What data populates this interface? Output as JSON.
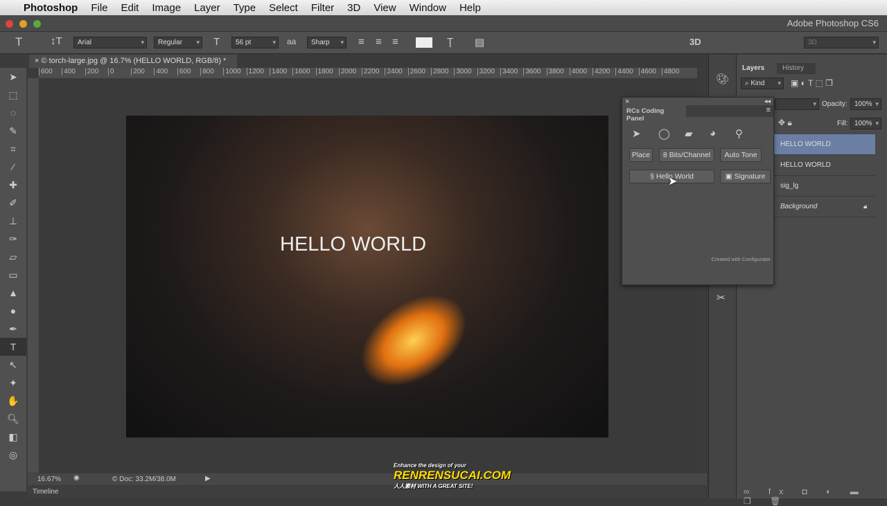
{
  "menubar": {
    "app": "Photoshop",
    "items": [
      "File",
      "Edit",
      "Image",
      "Layer",
      "Type",
      "Select",
      "Filter",
      "3D",
      "View",
      "Window",
      "Help"
    ]
  },
  "window": {
    "title": "Adobe Photoshop CS6"
  },
  "options": {
    "font_family": "Arial",
    "font_style": "Regular",
    "font_size": "56 pt",
    "antialias": "Sharp",
    "mode_3d": "3D",
    "workspace": "3D"
  },
  "document": {
    "tab": "© torch-large.jpg @ 16.7% (HELLO WORLD, RGB/8) *",
    "canvas_text": "HELLO WORLD",
    "ruler": [
      "600",
      "400",
      "200",
      "0",
      "200",
      "400",
      "600",
      "800",
      "1000",
      "1200",
      "1400",
      "1600",
      "1800",
      "2000",
      "2200",
      "2400",
      "2600",
      "2800",
      "3000",
      "3200",
      "3400",
      "3600",
      "3800",
      "4000",
      "4200",
      "4400",
      "4600",
      "4800"
    ]
  },
  "status": {
    "zoom": "16.67%",
    "doc": "Doc: 33.2M/38.0M"
  },
  "timeline": {
    "label": "Timeline"
  },
  "layers_panel": {
    "tabs": [
      "Layers",
      "History"
    ],
    "filter": "Kind",
    "opacity_label": "Opacity:",
    "opacity": "100%",
    "fill_label": "Fill:",
    "fill": "100%",
    "layers": [
      {
        "name": "HELLO WORLD",
        "selected": true
      },
      {
        "name": "HELLO WORLD",
        "selected": false
      },
      {
        "name": "sig_lg",
        "selected": false
      },
      {
        "name": "Background",
        "selected": false,
        "locked": true
      }
    ]
  },
  "rc_panel": {
    "title": "RCs Coding Panel",
    "buttons": [
      "Place",
      "8 Bits/Channel",
      "Auto Tone"
    ],
    "hello_button": "Hello World",
    "signature_button": "Signature",
    "footer": "Created with Configurator"
  },
  "watermark": {
    "tagline": "Enhance the design of your",
    "logo": "RENRENSUCAI.COM",
    "sub": "人人素材 WITH A GREAT SITE!"
  },
  "colors": {
    "selected_layer": "#6a7fa3",
    "panel": "#4a4a4a"
  }
}
